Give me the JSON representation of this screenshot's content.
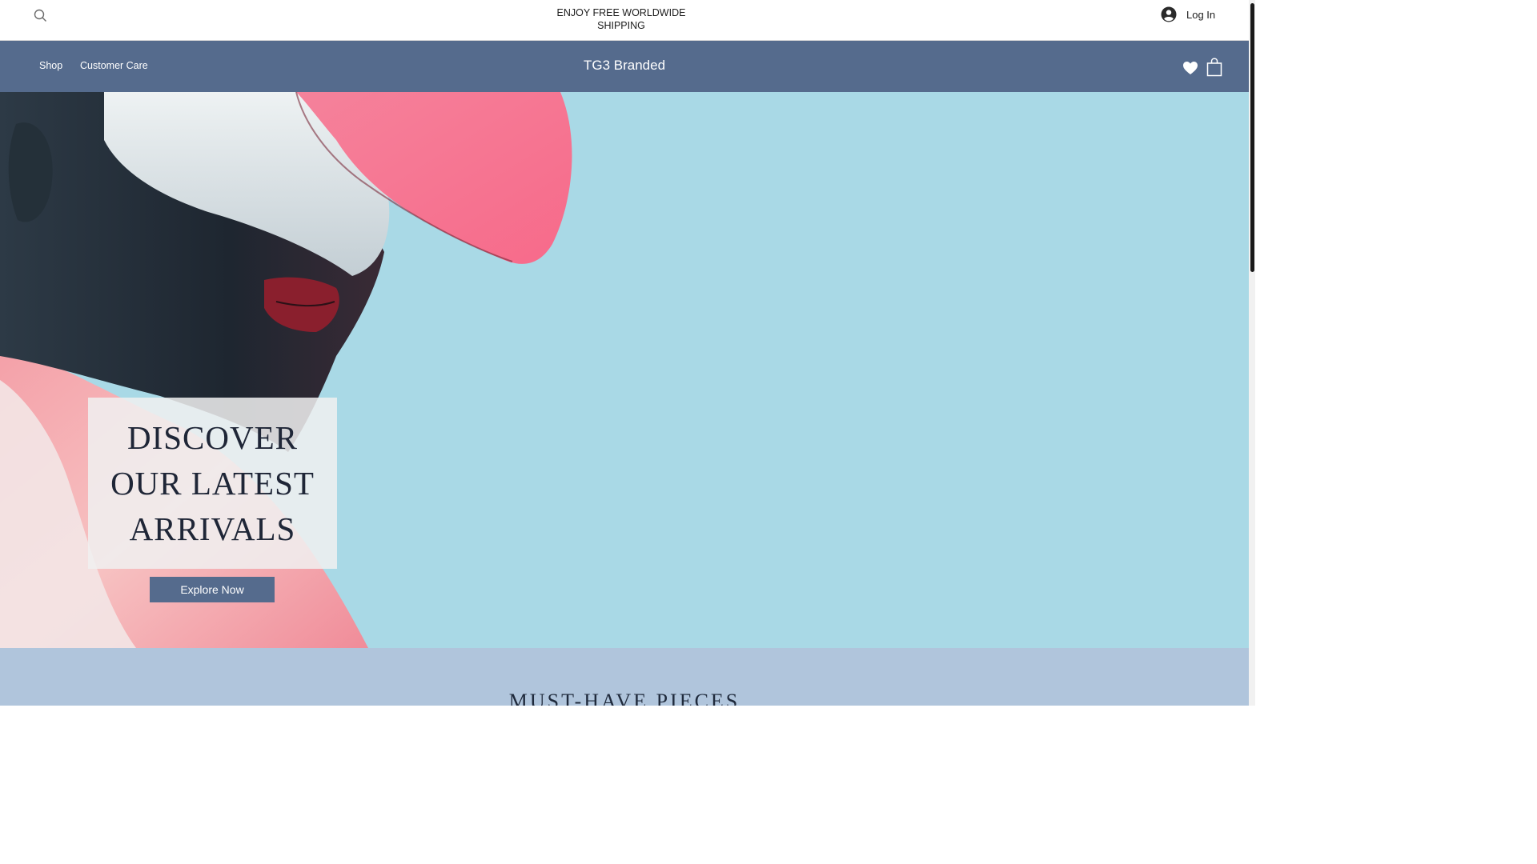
{
  "announcement": {
    "text": "ENJOY FREE WORLDWIDE SHIPPING"
  },
  "header": {
    "search_icon": "search-icon",
    "login_label": "Log In",
    "login_icon": "user-avatar-icon"
  },
  "nav": {
    "items": [
      {
        "label": "Shop"
      },
      {
        "label": "Customer Care"
      }
    ],
    "brand": "TG3 Branded",
    "wishlist_icon": "heart-icon",
    "cart_icon": "shopping-bag-icon"
  },
  "hero": {
    "title": "DISCOVER OUR LATEST ARRIVALS",
    "button_label": "Explore Now"
  },
  "next_section": {
    "title": "MUST-HAVE PIECES"
  },
  "colors": {
    "nav_background": "#556b8d",
    "hero_background": "#a9d9e6",
    "section_background": "#b0c5dc",
    "visor_pink": "#f2768f"
  }
}
